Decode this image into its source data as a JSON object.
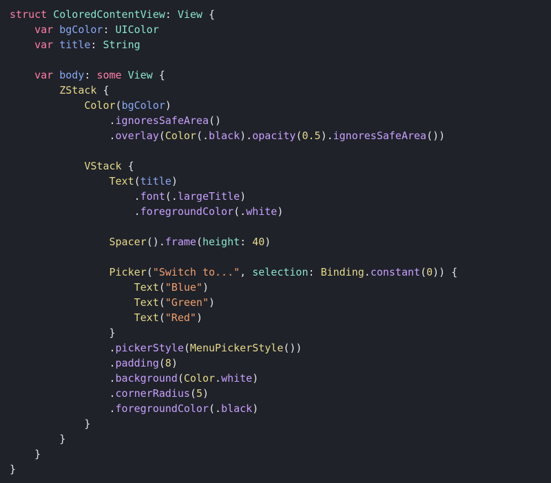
{
  "tokens": {
    "kw_struct": "struct",
    "kw_var1": "var",
    "kw_var2": "var",
    "kw_var3": "var",
    "kw_some": "some",
    "t_ColoredContentView": "ColoredContentView",
    "t_View1": "View",
    "t_View2": "View",
    "t_UIColor": "UIColor",
    "t_String": "String",
    "p_bgColor1": "bgColor",
    "p_title1": "title",
    "p_body": "body",
    "ty_ZStack": "ZStack",
    "ty_Color1": "Color",
    "p_bgColor2": "bgColor",
    "fn_ignoresSafeArea1": "ignoresSafeArea",
    "fn_overlay": "overlay",
    "ty_Color2": "Color",
    "fn_black1": "black",
    "fn_opacity": "opacity",
    "num_05": "0.5",
    "fn_ignoresSafeArea2": "ignoresSafeArea",
    "ty_VStack": "VStack",
    "ty_Text1": "Text",
    "p_title2": "title",
    "fn_font": "font",
    "fn_largeTitle": "largeTitle",
    "fn_foregroundColor1": "foregroundColor",
    "fn_white1": "white",
    "ty_Spacer": "Spacer",
    "fn_frame": "frame",
    "arg_height": "height",
    "num_40": "40",
    "ty_Picker": "Picker",
    "str_switch": "\"Switch to...\"",
    "arg_selection": "selection",
    "ty_Binding": "Binding",
    "fn_constant": "constant",
    "num_0": "0",
    "ty_Text2": "Text",
    "str_blue": "\"Blue\"",
    "ty_Text3": "Text",
    "str_green": "\"Green\"",
    "ty_Text4": "Text",
    "str_red": "\"Red\"",
    "fn_pickerStyle": "pickerStyle",
    "ty_MenuPickerStyle": "MenuPickerStyle",
    "fn_padding": "padding",
    "num_8": "8",
    "fn_background": "background",
    "ty_Color3": "Color",
    "fn_white2": "white",
    "fn_cornerRadius": "cornerRadius",
    "num_5": "5",
    "fn_foregroundColor2": "foregroundColor",
    "fn_black2": "black"
  }
}
